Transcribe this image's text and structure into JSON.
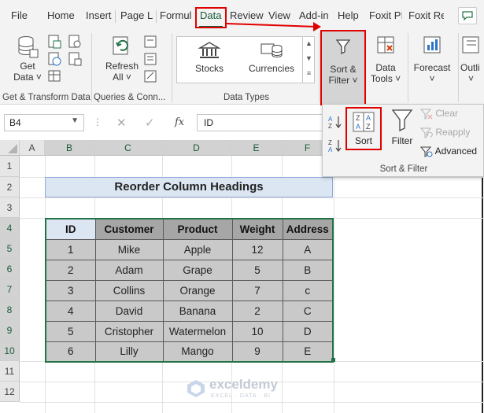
{
  "tabs": [
    "File",
    "Home",
    "Insert",
    "Page La",
    "Formul",
    "Data",
    "Review",
    "View",
    "Add-in",
    "Help",
    "Foxit PI",
    "Foxit Re"
  ],
  "active_tab": "Data",
  "ribbon": {
    "get_data": {
      "line1": "Get",
      "line2": "Data ˅"
    },
    "refresh_all": {
      "line1": "Refresh",
      "line2": "All ˅"
    },
    "stocks": "Stocks",
    "currencies": "Currencies",
    "sort_filter": {
      "line1": "Sort &",
      "line2": "Filter ˅"
    },
    "data_tools": {
      "line1": "Data",
      "line2": "Tools ˅"
    },
    "forecast": {
      "line1": "Forecast",
      "line2": "˅"
    },
    "outline": {
      "line1": "Outli",
      "line2": "˅"
    },
    "groups": {
      "get_transform": "Get & Transform Data",
      "queries": "Queries & Conn...",
      "data_types": "Data Types"
    }
  },
  "formula_bar": {
    "name_box": "B4",
    "fx": "fx",
    "content": "ID"
  },
  "columns": [
    "A",
    "B",
    "C",
    "D",
    "E",
    "F"
  ],
  "rows": [
    "1",
    "2",
    "3",
    "4",
    "5",
    "6",
    "7",
    "8",
    "9",
    "10",
    "11",
    "12"
  ],
  "sheet": {
    "title": "Reorder Column Headings",
    "headers": [
      "ID",
      "Customer",
      "Product",
      "Weight",
      "Address"
    ],
    "data": [
      [
        "1",
        "Mike",
        "Apple",
        "12",
        "A"
      ],
      [
        "2",
        "Adam",
        "Grape",
        "5",
        "B"
      ],
      [
        "3",
        "Collins",
        "Orange",
        "7",
        "c"
      ],
      [
        "4",
        "David",
        "Banana",
        "2",
        "C"
      ],
      [
        "5",
        "Cristopher",
        "Watermelon",
        "10",
        "D"
      ],
      [
        "6",
        "Lilly",
        "Mango",
        "9",
        "E"
      ]
    ]
  },
  "dropdown": {
    "sort": "Sort",
    "filter": "Filter",
    "clear": "Clear",
    "reapply": "Reapply",
    "advanced": "Advanced",
    "group_label": "Sort & Filter"
  },
  "watermark": {
    "name": "exceldemy",
    "tagline": "EXCEL · DATA · BI"
  },
  "colors": {
    "excel_green": "#217346",
    "highlight_red": "#e00000",
    "title_fill": "#dce6f2",
    "header_fill": "#a6a6a6",
    "cell_fill": "#c9c9c9"
  }
}
